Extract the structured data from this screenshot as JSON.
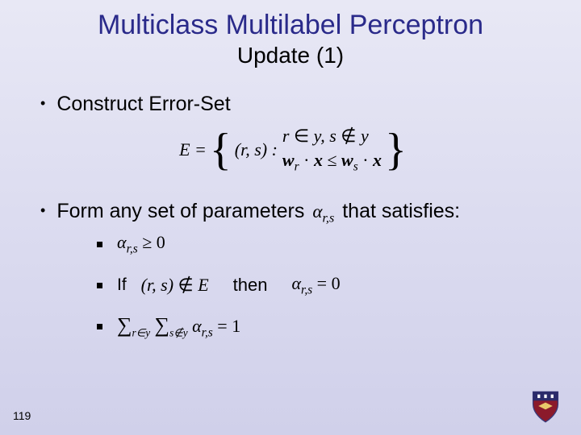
{
  "slide": {
    "title": "Multiclass Multilabel Perceptron",
    "subtitle": "Update (1)",
    "page_number": "119"
  },
  "bullets": {
    "b1": "Construct Error-Set",
    "b2_pre": "Form any set of parameters",
    "b2_alpha": "α",
    "b2_alpha_sub": "r,s",
    "b2_post": "that satisfies:"
  },
  "error_set": {
    "lhs": "E =",
    "pair": "(r, s) :",
    "cond1_pre": "r ∈ y, s ∉ y",
    "cond2": "w",
    "cond2_r": "r",
    "cond2_mid": "· x ≤ w",
    "cond2_s": "s",
    "cond2_end": "· x"
  },
  "sub": {
    "s1_alpha": "α",
    "s1_sub": "r,s",
    "s1_op": " ≥ 0",
    "s2_if": "If",
    "s2_pair": "(r, s) ∉ E",
    "s2_then": "then",
    "s2_alpha": "α",
    "s2_sub": "r,s",
    "s2_eq": " = 0",
    "s3_sum1": "∑",
    "s3_sub1": "r∈y",
    "s3_sum2": "∑",
    "s3_sub2": "s∉y",
    "s3_alpha": "α",
    "s3_asub": "r,s",
    "s3_eq": " = 1"
  }
}
